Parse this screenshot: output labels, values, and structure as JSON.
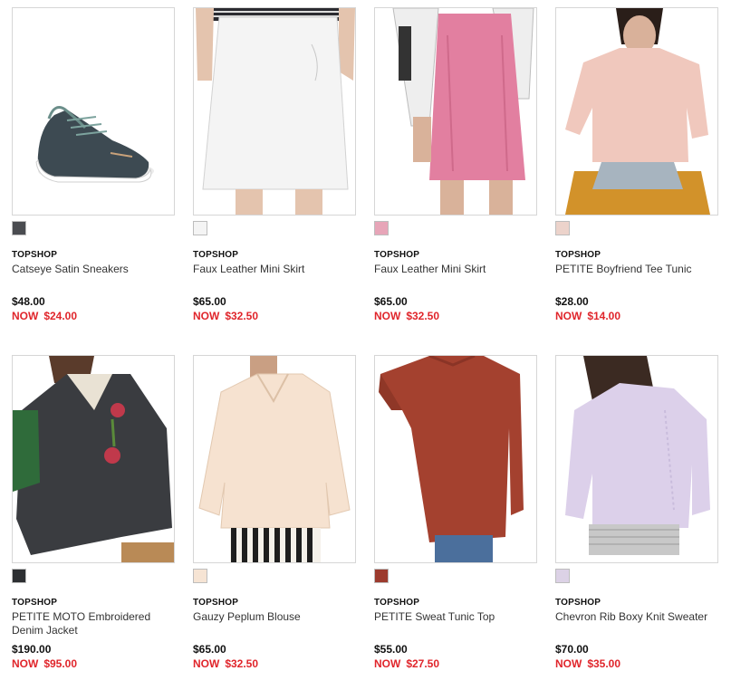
{
  "products": [
    {
      "brand": "TOPSHOP",
      "name": "Catseye Satin Sneakers",
      "price": "$48.00",
      "now_label": "NOW",
      "sale_price": "$24.00",
      "swatch": "#4a4c50",
      "image": "sneaker"
    },
    {
      "brand": "TOPSHOP",
      "name": "Faux Leather Mini Skirt",
      "price": "$65.00",
      "now_label": "NOW",
      "sale_price": "$32.50",
      "swatch": "#f4f4f4",
      "image": "white-skirt"
    },
    {
      "brand": "TOPSHOP",
      "name": "Faux Leather Mini Skirt",
      "price": "$65.00",
      "now_label": "NOW",
      "sale_price": "$32.50",
      "swatch": "#e7a5b8",
      "image": "pink-skirt"
    },
    {
      "brand": "TOPSHOP",
      "name": "PETITE Boyfriend Tee Tunic",
      "price": "$28.00",
      "now_label": "NOW",
      "sale_price": "$14.00",
      "swatch": "#ecd3cb",
      "image": "tee-tunic"
    },
    {
      "brand": "TOPSHOP",
      "name": "PETITE MOTO Embroidered Denim Jacket",
      "price": "$190.00",
      "now_label": "NOW",
      "sale_price": "$95.00",
      "swatch": "#2d2f32",
      "image": "denim-jacket"
    },
    {
      "brand": "TOPSHOP",
      "name": "Gauzy Peplum Blouse",
      "price": "$65.00",
      "now_label": "NOW",
      "sale_price": "$32.50",
      "swatch": "#f6e4d4",
      "image": "peplum-blouse"
    },
    {
      "brand": "TOPSHOP",
      "name": "PETITE Sweat Tunic Top",
      "price": "$55.00",
      "now_label": "NOW",
      "sale_price": "$27.50",
      "swatch": "#9c3b2e",
      "image": "sweat-tunic"
    },
    {
      "brand": "TOPSHOP",
      "name": "Chevron Rib Boxy Knit Sweater",
      "price": "$70.00",
      "now_label": "NOW",
      "sale_price": "$35.00",
      "swatch": "#dcd2e6",
      "image": "knit-sweater"
    }
  ]
}
